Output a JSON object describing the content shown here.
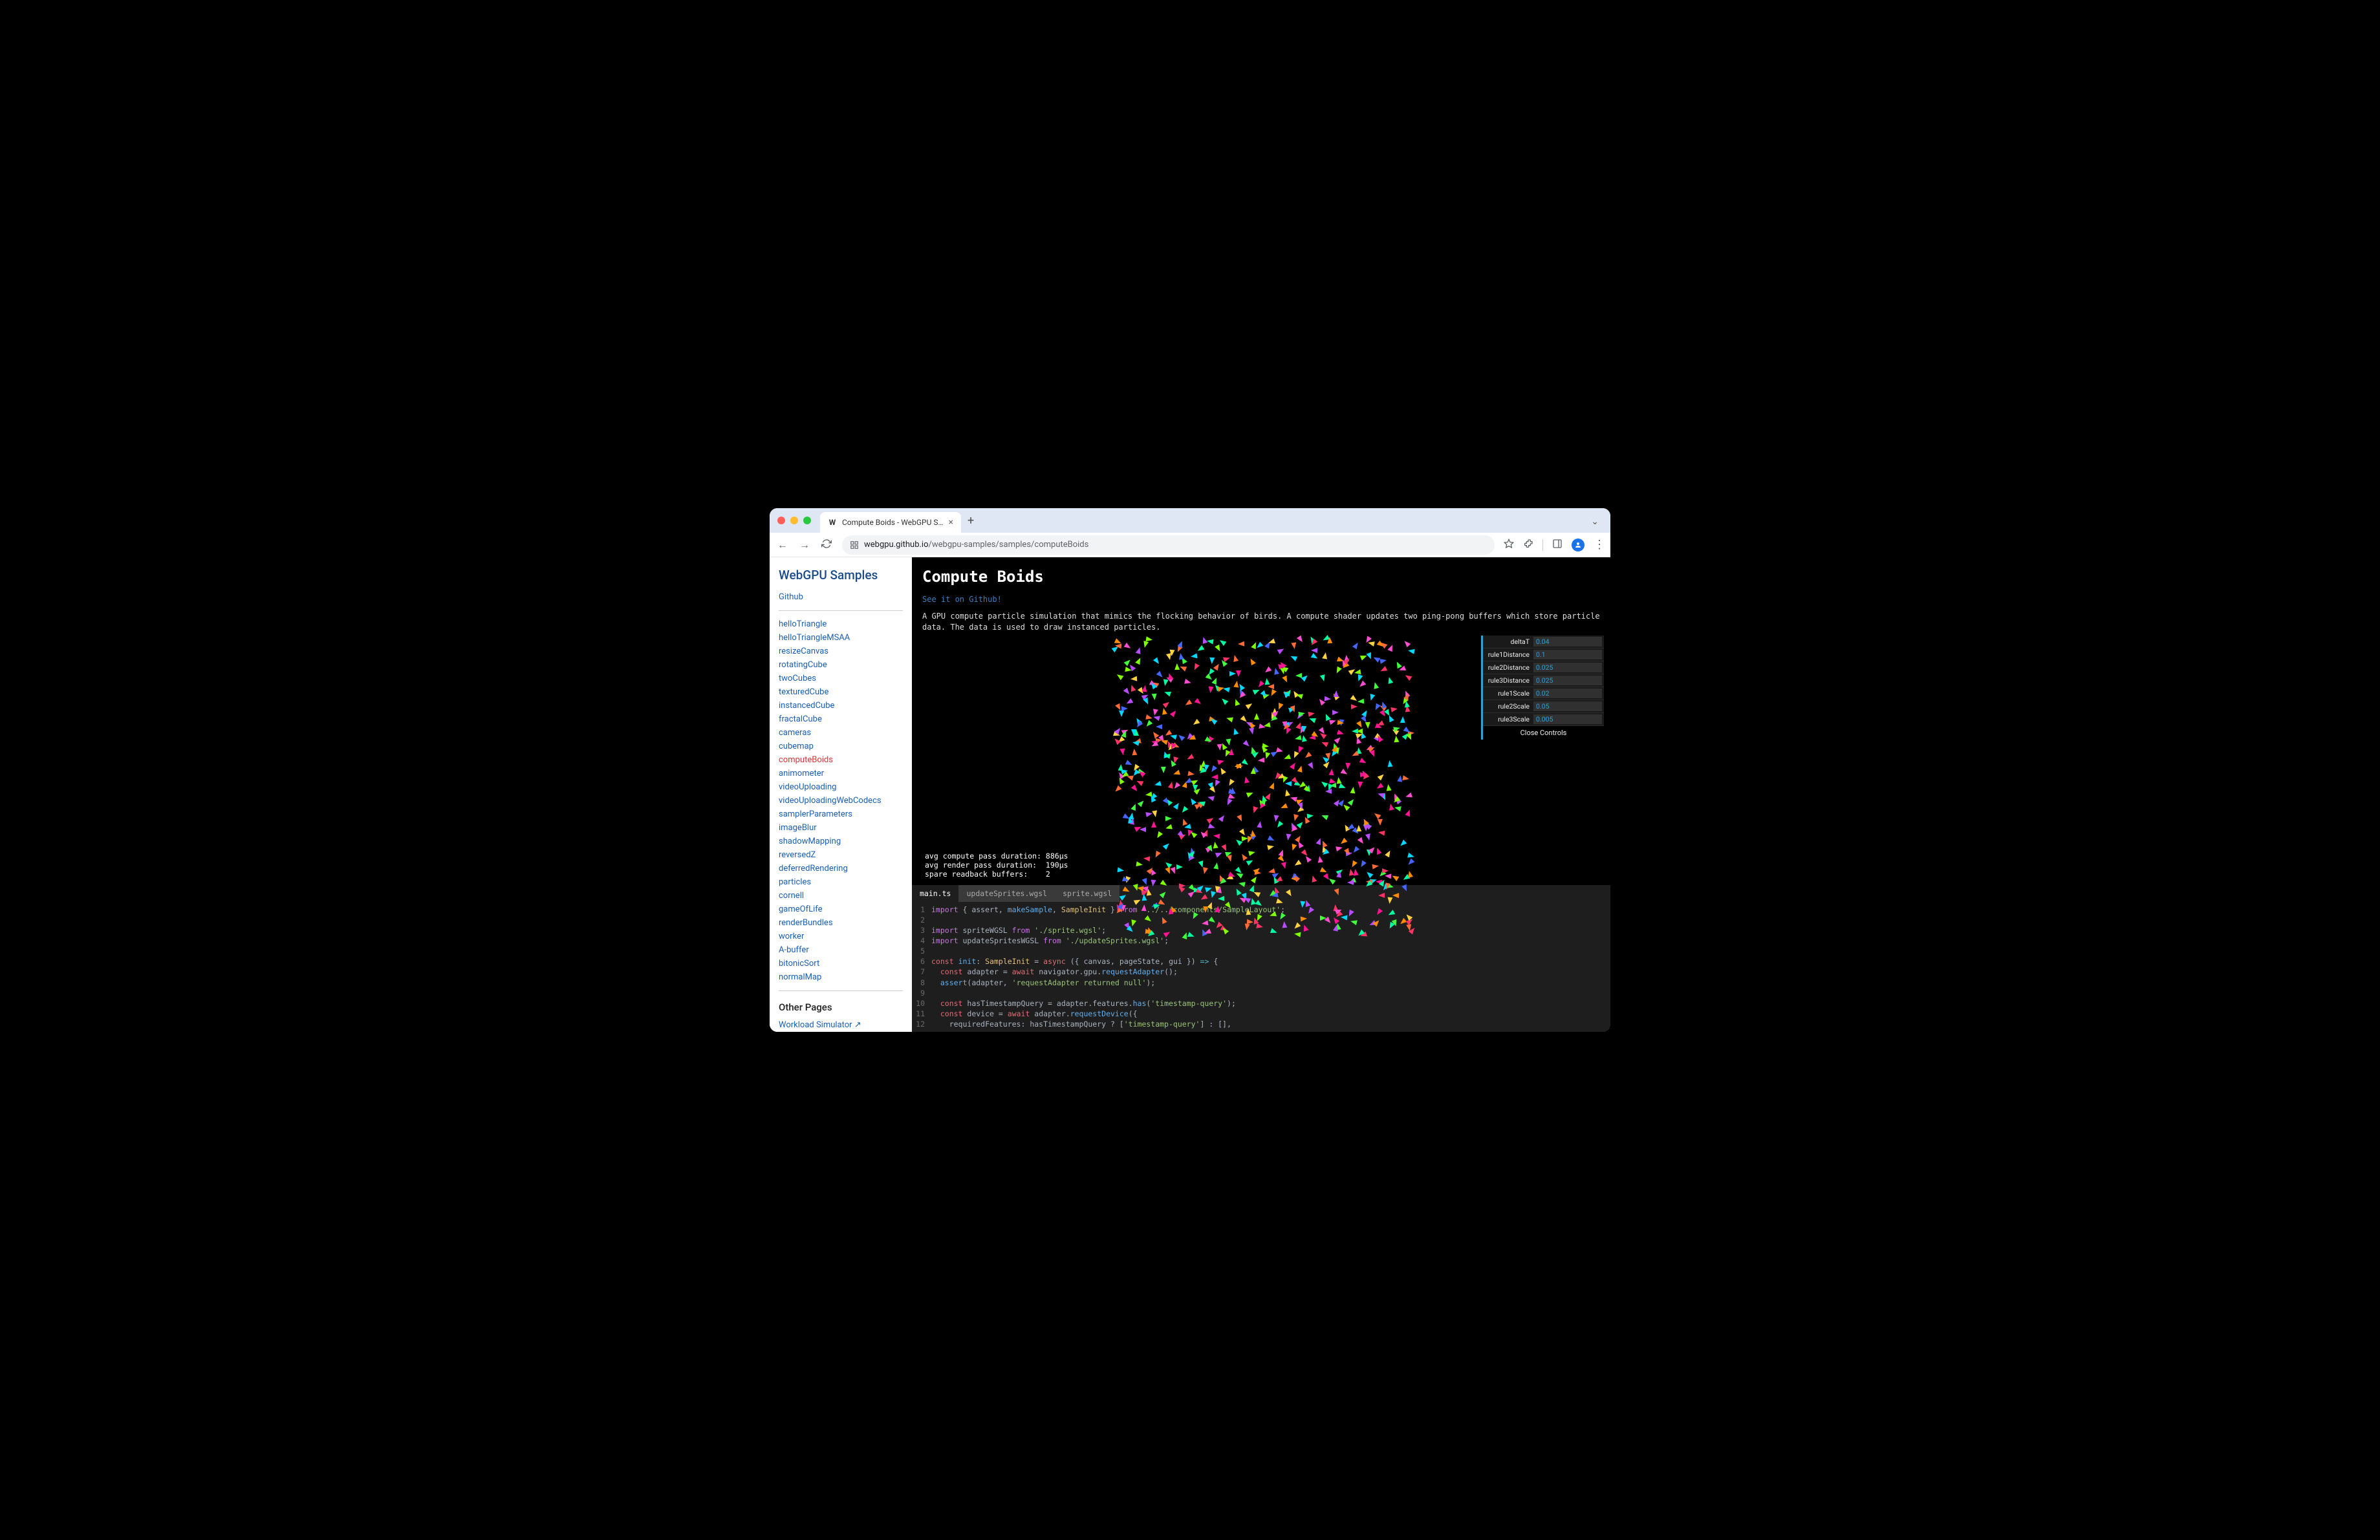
{
  "browser": {
    "tab_title": "Compute Boids - WebGPU S…",
    "url_domain": "webgpu.github.io",
    "url_path": "/webgpu-samples/samples/computeBoids"
  },
  "sidebar": {
    "title": "WebGPU Samples",
    "github_label": "Github",
    "items": [
      "helloTriangle",
      "helloTriangleMSAA",
      "resizeCanvas",
      "rotatingCube",
      "twoCubes",
      "texturedCube",
      "instancedCube",
      "fractalCube",
      "cameras",
      "cubemap",
      "computeBoids",
      "animometer",
      "videoUploading",
      "videoUploadingWebCodecs",
      "samplerParameters",
      "imageBlur",
      "shadowMapping",
      "reversedZ",
      "deferredRendering",
      "particles",
      "cornell",
      "gameOfLife",
      "renderBundles",
      "worker",
      "A-buffer",
      "bitonicSort",
      "normalMap"
    ],
    "active": "computeBoids",
    "other_pages_title": "Other Pages",
    "other_pages": [
      "Workload Simulator ↗"
    ]
  },
  "page": {
    "title": "Compute Boids",
    "github_link": "See it on Github!",
    "description": "A GPU compute particle simulation that mimics the flocking behavior of birds. A compute shader updates two ping-pong buffers which store particle data. The data is used to draw instanced particles."
  },
  "stats": {
    "line1": "avg compute pass duration: 886µs",
    "line2": "avg render pass duration:  190µs",
    "line3": "spare readback buffers:    2"
  },
  "gui": {
    "params": [
      {
        "label": "deltaT",
        "value": "0.04"
      },
      {
        "label": "rule1Distance",
        "value": "0.1"
      },
      {
        "label": "rule2Distance",
        "value": "0.025"
      },
      {
        "label": "rule3Distance",
        "value": "0.025"
      },
      {
        "label": "rule1Scale",
        "value": "0.02"
      },
      {
        "label": "rule2Scale",
        "value": "0.05"
      },
      {
        "label": "rule3Scale",
        "value": "0.005"
      }
    ],
    "close_label": "Close Controls"
  },
  "code": {
    "tabs": [
      "main.ts",
      "updateSprites.wgsl",
      "sprite.wgsl"
    ],
    "active_tab": "main.ts",
    "lines": [
      {
        "n": 1,
        "tokens": [
          [
            "kw",
            "import"
          ],
          [
            "punc",
            " { "
          ],
          [
            "plain",
            "assert"
          ],
          [
            "punc",
            ", "
          ],
          [
            "fn",
            "makeSample"
          ],
          [
            "punc",
            ", "
          ],
          [
            "var",
            "SampleInit"
          ],
          [
            "punc",
            " } "
          ],
          [
            "kw",
            "from"
          ],
          [
            "punc",
            " "
          ],
          [
            "str",
            "'../../components/SampleLayout'"
          ],
          [
            "punc",
            ";"
          ]
        ]
      },
      {
        "n": 2,
        "tokens": []
      },
      {
        "n": 3,
        "tokens": [
          [
            "kw",
            "import"
          ],
          [
            "punc",
            " "
          ],
          [
            "plain",
            "spriteWGSL "
          ],
          [
            "kw",
            "from"
          ],
          [
            "punc",
            " "
          ],
          [
            "str",
            "'./sprite.wgsl'"
          ],
          [
            "punc",
            ";"
          ]
        ]
      },
      {
        "n": 4,
        "tokens": [
          [
            "kw",
            "import"
          ],
          [
            "punc",
            " "
          ],
          [
            "plain",
            "updateSpritesWGSL "
          ],
          [
            "kw",
            "from"
          ],
          [
            "punc",
            " "
          ],
          [
            "str",
            "'./updateSprites.wgsl'"
          ],
          [
            "punc",
            ";"
          ]
        ]
      },
      {
        "n": 5,
        "tokens": []
      },
      {
        "n": 6,
        "tokens": [
          [
            "kw2",
            "const"
          ],
          [
            "punc",
            " "
          ],
          [
            "fn",
            "init"
          ],
          [
            "punc",
            ": "
          ],
          [
            "var",
            "SampleInit"
          ],
          [
            "punc",
            " = "
          ],
          [
            "kw2",
            "async"
          ],
          [
            "punc",
            " ({ "
          ],
          [
            "plain",
            "canvas"
          ],
          [
            "punc",
            ", "
          ],
          [
            "plain",
            "pageState"
          ],
          [
            "punc",
            ", "
          ],
          [
            "plain",
            "gui"
          ],
          [
            "punc",
            " }) "
          ],
          [
            "op",
            "=>"
          ],
          [
            "punc",
            " {"
          ]
        ]
      },
      {
        "n": 7,
        "tokens": [
          [
            "punc",
            "  "
          ],
          [
            "kw2",
            "const"
          ],
          [
            "punc",
            " "
          ],
          [
            "plain",
            "adapter"
          ],
          [
            "punc",
            " = "
          ],
          [
            "kw2",
            "await"
          ],
          [
            "punc",
            " navigator.gpu."
          ],
          [
            "fn",
            "requestAdapter"
          ],
          [
            "punc",
            "();"
          ]
        ]
      },
      {
        "n": 8,
        "tokens": [
          [
            "punc",
            "  "
          ],
          [
            "fn",
            "assert"
          ],
          [
            "punc",
            "(adapter, "
          ],
          [
            "str",
            "'requestAdapter returned null'"
          ],
          [
            "punc",
            ");"
          ]
        ]
      },
      {
        "n": 9,
        "tokens": []
      },
      {
        "n": 10,
        "tokens": [
          [
            "punc",
            "  "
          ],
          [
            "kw2",
            "const"
          ],
          [
            "punc",
            " "
          ],
          [
            "plain",
            "hasTimestampQuery"
          ],
          [
            "punc",
            " = adapter.features."
          ],
          [
            "fn",
            "has"
          ],
          [
            "punc",
            "("
          ],
          [
            "str",
            "'timestamp-query'"
          ],
          [
            "punc",
            ");"
          ]
        ]
      },
      {
        "n": 11,
        "tokens": [
          [
            "punc",
            "  "
          ],
          [
            "kw2",
            "const"
          ],
          [
            "punc",
            " "
          ],
          [
            "plain",
            "device"
          ],
          [
            "punc",
            " = "
          ],
          [
            "kw2",
            "await"
          ],
          [
            "punc",
            " adapter."
          ],
          [
            "fn",
            "requestDevice"
          ],
          [
            "punc",
            "({"
          ]
        ]
      },
      {
        "n": 12,
        "tokens": [
          [
            "punc",
            "    "
          ],
          [
            "plain",
            "requiredFeatures"
          ],
          [
            "punc",
            ": hasTimestampQuery ? ["
          ],
          [
            "str",
            "'timestamp-query'"
          ],
          [
            "punc",
            "] : [],"
          ]
        ]
      }
    ]
  },
  "boid_colors": [
    "#ff3366",
    "#ff6b35",
    "#ffd23f",
    "#3fff3f",
    "#00d9ff",
    "#4466ff",
    "#b84dff",
    "#ff4dd2",
    "#ff8c00",
    "#7fff00",
    "#00ffa3",
    "#ff1493"
  ]
}
